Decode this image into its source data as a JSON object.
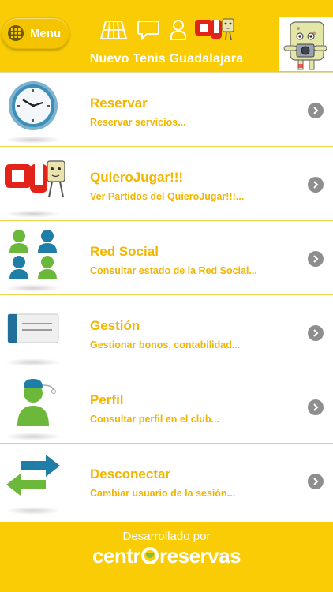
{
  "header": {
    "menu_label": "Menu",
    "title": "Nuevo Tenis Guadalajara",
    "icons": [
      "court-icon",
      "chat-icon",
      "user-icon",
      "quierojugar-logo-icon"
    ]
  },
  "menu": {
    "items": [
      {
        "title": "Reservar",
        "subtitle": "Reservar servicios...",
        "icon": "clock-icon"
      },
      {
        "title": "QuieroJugar!!!",
        "subtitle": "Ver Partidos del QuieroJugar!!!...",
        "icon": "quierojugar-icon"
      },
      {
        "title": "Red Social",
        "subtitle": "Consultar estado de la Red Social...",
        "icon": "social-network-icon"
      },
      {
        "title": "Gestión",
        "subtitle": "Gestionar bonos, contabilidad...",
        "icon": "card-icon"
      },
      {
        "title": "Perfil",
        "subtitle": "Consultar perfil en el club...",
        "icon": "profile-icon"
      },
      {
        "title": "Desconectar",
        "subtitle": "Cambiar usuario de la sesión...",
        "icon": "swap-arrows-icon"
      }
    ]
  },
  "footer": {
    "developed_by": "Desarrollado por",
    "brand_prefix": "centr",
    "brand_suffix": "reservas"
  },
  "colors": {
    "accent": "#f9cc06",
    "text_accent": "#f2b500",
    "chevron": "#8e8e8e"
  }
}
